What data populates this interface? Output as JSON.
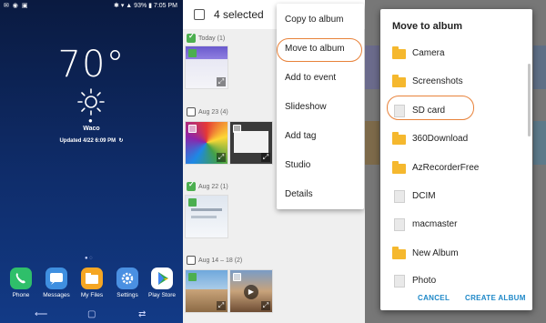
{
  "home": {
    "status_left": "✉ ◉ ▣",
    "status_right": "✱ ▾ ▲ 93% ▮ 7:05 PM",
    "temperature": "70°",
    "weather_icon": "sun-icon",
    "city": "Waco",
    "updated": "Updated 4/22 6:09 PM",
    "page_dots": "● ◌",
    "dock": [
      {
        "label": "Phone",
        "icon": "phone-icon",
        "color": "#2fbf6a"
      },
      {
        "label": "Messages",
        "icon": "messages-icon",
        "color": "#3f8fe0"
      },
      {
        "label": "My Files",
        "icon": "folder-icon",
        "color": "#f5a623"
      },
      {
        "label": "Settings",
        "icon": "gear-icon",
        "color": "#4a90e2"
      },
      {
        "label": "Play Store",
        "icon": "play-store-icon",
        "color": "#ffffff"
      }
    ],
    "nav": {
      "back": "⟵",
      "home": "▢",
      "recent": "⇄"
    }
  },
  "gallery": {
    "selected_text": "4 selected",
    "groups": [
      {
        "date": "Today (1)",
        "checked": true
      },
      {
        "date": "Aug 23 (4)",
        "checked": false
      },
      {
        "date": "Aug 22 (1)",
        "checked": true
      },
      {
        "date": "Aug 14 – 18 (2)",
        "checked": false
      }
    ],
    "menu": [
      "Copy to album",
      "Move to album",
      "Add to event",
      "Slideshow",
      "Add tag",
      "Studio",
      "Details"
    ],
    "expand_glyph": "⤢"
  },
  "dialog": {
    "title": "Move to album",
    "albums": [
      {
        "name": "Camera",
        "type": "folder"
      },
      {
        "name": "Screenshots",
        "type": "folder"
      },
      {
        "name": "SD card",
        "type": "file"
      },
      {
        "name": "360Download",
        "type": "folder"
      },
      {
        "name": "AzRecorderFree",
        "type": "folder"
      },
      {
        "name": "DCIM",
        "type": "file"
      },
      {
        "name": "macmaster",
        "type": "file"
      },
      {
        "name": "New Album",
        "type": "folder"
      },
      {
        "name": "Photo",
        "type": "file"
      }
    ],
    "cancel": "CANCEL",
    "create": "CREATE ALBUM"
  }
}
